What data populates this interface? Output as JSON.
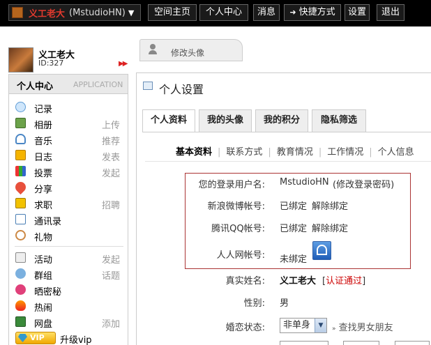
{
  "topbar": {
    "brand_name": "义工老大",
    "brand_handle": "(MstudioHN)",
    "nav": [
      "空间主页",
      "个人中心",
      "消息",
      "快捷方式",
      "设置",
      "退出"
    ]
  },
  "profile": {
    "name": "义工老大",
    "id": "ID:327"
  },
  "avatar_tab": {
    "label": "修改头像"
  },
  "sidebar": {
    "title": "个人中心",
    "app_label": "APPLICATION",
    "items": [
      {
        "label": "记录",
        "extra": ""
      },
      {
        "label": "相册",
        "extra": "上传"
      },
      {
        "label": "音乐",
        "extra": "推荐"
      },
      {
        "label": "日志",
        "extra": "发表"
      },
      {
        "label": "投票",
        "extra": "发起"
      },
      {
        "label": "分享",
        "extra": ""
      },
      {
        "label": "求职",
        "extra": "招聘"
      },
      {
        "label": "通讯录",
        "extra": ""
      },
      {
        "label": "礼物",
        "extra": ""
      },
      {
        "label": "活动",
        "extra": "发起"
      },
      {
        "label": "群组",
        "extra": "话题"
      },
      {
        "label": "晒密秘",
        "extra": ""
      },
      {
        "label": "热闹",
        "extra": ""
      },
      {
        "label": "网盘",
        "extra": "添加"
      },
      {
        "label": "升级vip",
        "extra": "",
        "badge": "VIP"
      }
    ]
  },
  "main": {
    "title": "个人设置",
    "tabs": [
      "个人资料",
      "我的头像",
      "我的积分",
      "隐私筛选"
    ],
    "subnav": [
      "基本资料",
      "联系方式",
      "教育情况",
      "工作情况",
      "个人信息"
    ],
    "bindings": {
      "login_label": "您的登录用户名:",
      "login_value": "MstudioHN",
      "login_link": "(修改登录密码)",
      "weibo_label": "新浪微博帐号:",
      "weibo_status": "已绑定",
      "weibo_action": "解除绑定",
      "qq_label": "腾讯QQ帐号:",
      "qq_status": "已绑定",
      "qq_action": "解除绑定",
      "renren_label": "人人网帐号:",
      "renren_status": "未绑定"
    },
    "realname_label": "真实姓名:",
    "realname_value": "义工老大",
    "realname_verify": "认证通过",
    "gender_label": "性别:",
    "gender_value": "男",
    "marital_label": "婚恋状态:",
    "marital_value": "非单身",
    "find_link": "查找男女朋友"
  },
  "colors": {
    "brand_red": "#e23a2e",
    "bind_box_border": "#aa3333",
    "verify_red": "#cc0000"
  }
}
